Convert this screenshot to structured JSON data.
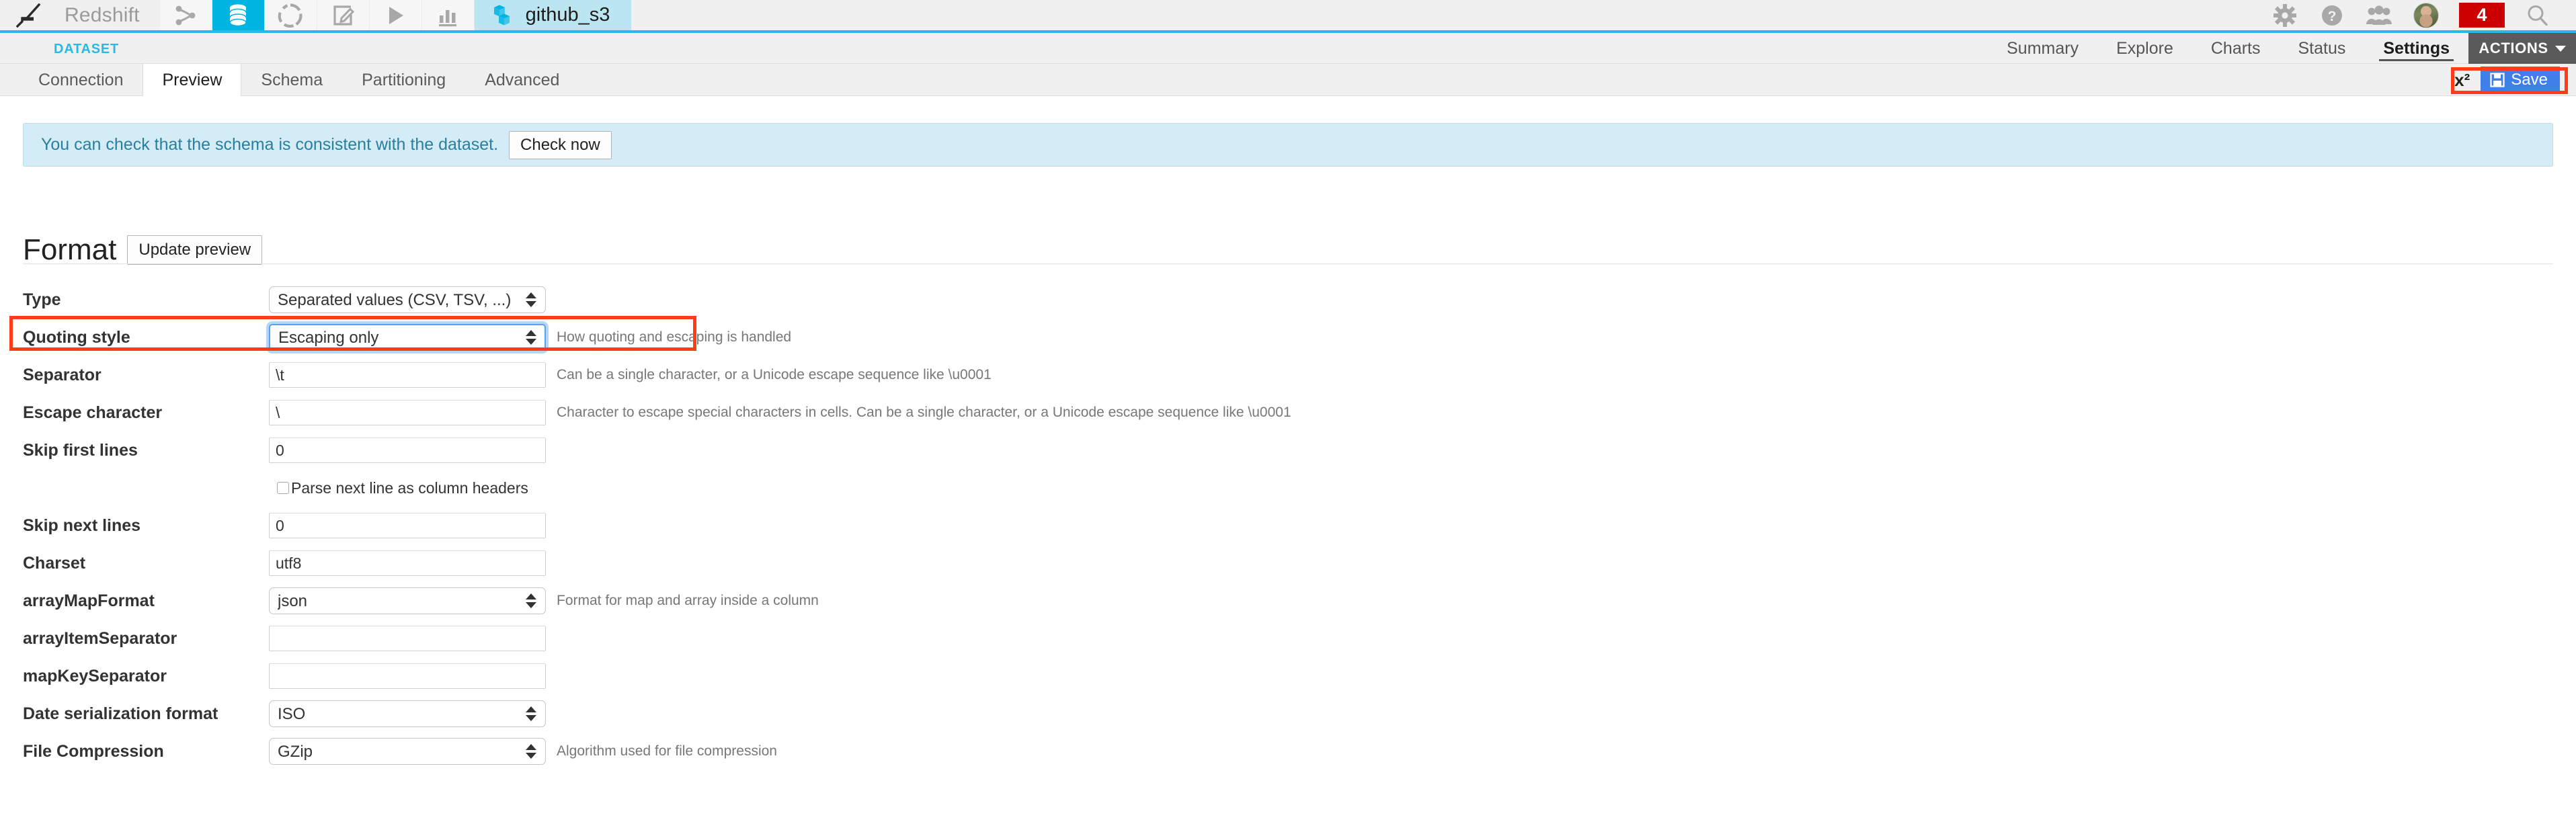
{
  "topbar": {
    "logo_icon": "dataiku-bird-logo",
    "project_name": "Redshift",
    "icons": [
      {
        "name": "flow-icon",
        "selected": false
      },
      {
        "name": "datasets-icon",
        "selected": true
      },
      {
        "name": "recipes-icon",
        "selected": false
      },
      {
        "name": "notebooks-icon",
        "selected": false
      },
      {
        "name": "scenarios-icon",
        "selected": false
      },
      {
        "name": "dashboards-icon",
        "selected": false
      }
    ],
    "dataset_icon": "dataset-cube-icon",
    "dataset_name": "github_s3",
    "right": {
      "gear_icon": "gear-icon",
      "help_icon": "help-icon",
      "users_icon": "users-icon",
      "avatar": "user-avatar",
      "notification_count": "4",
      "notification_color": "#cc0000",
      "search_icon": "search-icon"
    }
  },
  "subnav": {
    "section_label": "DATASET",
    "section_label_color": "#28b9e7",
    "right_nav": [
      {
        "label": "Summary",
        "active": false
      },
      {
        "label": "Explore",
        "active": false
      },
      {
        "label": "Charts",
        "active": false
      },
      {
        "label": "Status",
        "active": false
      },
      {
        "label": "Settings",
        "active": true
      }
    ],
    "actions_label": "ACTIONS"
  },
  "tabs": [
    {
      "label": "Connection",
      "active": false
    },
    {
      "label": "Preview",
      "active": true
    },
    {
      "label": "Schema",
      "active": false
    },
    {
      "label": "Partitioning",
      "active": false
    },
    {
      "label": "Advanced",
      "active": false
    }
  ],
  "toolbar": {
    "x2_label": "x²",
    "save_label": "Save",
    "save_icon": "floppy-disk-icon",
    "save_color": "#3e7fe8",
    "highlight_color": "#ff3b18"
  },
  "banner": {
    "text": "You can check that the schema is consistent with the dataset.",
    "button_label": "Check now",
    "background": "#d4ecf6",
    "text_color": "#2a7fa0"
  },
  "format": {
    "title": "Format",
    "update_preview_label": "Update preview",
    "rows": [
      {
        "label": "Type",
        "control": "select",
        "value": "Separated values (CSV, TSV, ...)",
        "options": [
          "Separated values (CSV, TSV, ...)"
        ],
        "help": "",
        "focused": false,
        "highlighted": false
      },
      {
        "label": "Quoting style",
        "control": "select",
        "value": "Escaping only",
        "options": [
          "Escaping only"
        ],
        "help": "How quoting and escaping is handled",
        "focused": true,
        "highlighted": true
      },
      {
        "label": "Separator",
        "control": "text",
        "value": "\\t",
        "help": "Can be a single character, or a Unicode escape sequence like \\u0001",
        "focused": false,
        "highlighted": false
      },
      {
        "label": "Escape character",
        "control": "text",
        "value": "\\",
        "help": "Character to escape special characters in cells. Can be a single character, or a Unicode escape sequence like \\u0001",
        "focused": false,
        "highlighted": false
      },
      {
        "label": "Skip first lines",
        "control": "text",
        "value": "0",
        "help": "",
        "focused": false,
        "highlighted": false
      },
      {
        "label": "",
        "control": "checkbox",
        "value": "",
        "checkbox_label": "Parse next line as column headers",
        "checked": false,
        "help": "",
        "focused": false,
        "highlighted": false
      },
      {
        "label": "Skip next lines",
        "control": "text",
        "value": "0",
        "help": "",
        "focused": false,
        "highlighted": false
      },
      {
        "label": "Charset",
        "control": "text",
        "value": "utf8",
        "help": "",
        "focused": false,
        "highlighted": false
      },
      {
        "label": "arrayMapFormat",
        "control": "select",
        "value": "json",
        "options": [
          "json"
        ],
        "help": "Format for map and array inside a column",
        "focused": false,
        "highlighted": false
      },
      {
        "label": "arrayItemSeparator",
        "control": "text",
        "value": "",
        "help": "",
        "focused": false,
        "highlighted": false
      },
      {
        "label": "mapKeySeparator",
        "control": "text",
        "value": "",
        "help": "",
        "focused": false,
        "highlighted": false
      },
      {
        "label": "Date serialization format",
        "control": "select",
        "value": "ISO",
        "options": [
          "ISO"
        ],
        "help": "",
        "focused": false,
        "highlighted": false
      },
      {
        "label": "File Compression",
        "control": "select",
        "value": "GZip",
        "options": [
          "GZip"
        ],
        "help": "Algorithm used for file compression",
        "focused": false,
        "highlighted": false
      }
    ]
  }
}
